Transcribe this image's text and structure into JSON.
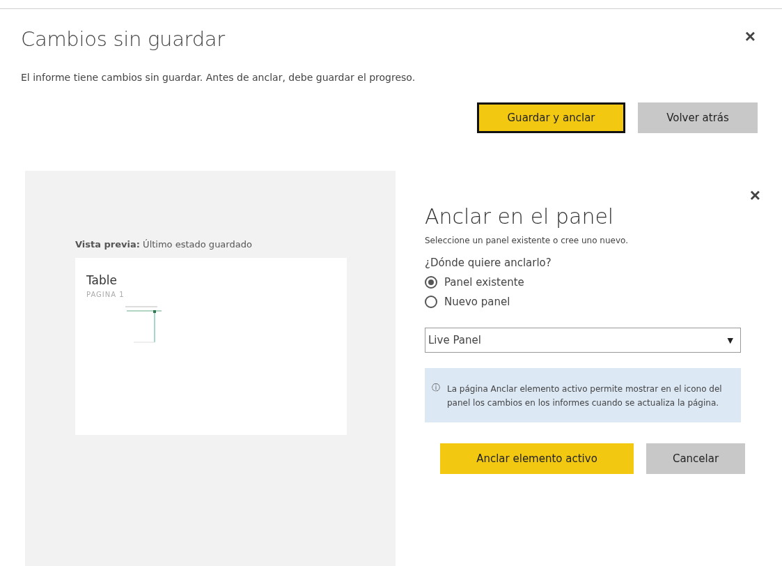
{
  "dialog": {
    "title": "Cambios sin guardar",
    "message": "El informe tiene cambios sin guardar. Antes de anclar, debe guardar el progreso.",
    "close": "×",
    "buttons": [
      {
        "label": "Guardar y anclar",
        "kind": "primary",
        "focused": true
      },
      {
        "label": "Volver atrás",
        "kind": "secondary",
        "focused": false
      }
    ]
  },
  "preview": {
    "caption": "**Vista previa:** Último estado guardado",
    "tile_title": "Table",
    "tile_subtitle": "PAGINA 1"
  },
  "pin_panel": {
    "close": "×",
    "title": "Anclar en el panel",
    "subtitle": "Seleccione un panel existente o cree uno nuevo.",
    "question": "¿Dónde quiere anclarlo?",
    "options": [
      {
        "label": "Panel existente",
        "selected": true
      },
      {
        "label": "Nuevo panel",
        "selected": false
      }
    ],
    "dropdown": {
      "value": "Live Panel",
      "arrow": "▼"
    },
    "info": {
      "icon": "ⓘ",
      "text": "La página Anclar elemento activo permite mostrar en el icono del panel los cambios en los informes cuando se actualiza la página."
    },
    "buttons": [
      {
        "label": "Anclar elemento activo",
        "kind": "primary",
        "focused": false
      },
      {
        "label": "Cancelar",
        "kind": "secondary",
        "focused": false
      }
    ]
  }
}
